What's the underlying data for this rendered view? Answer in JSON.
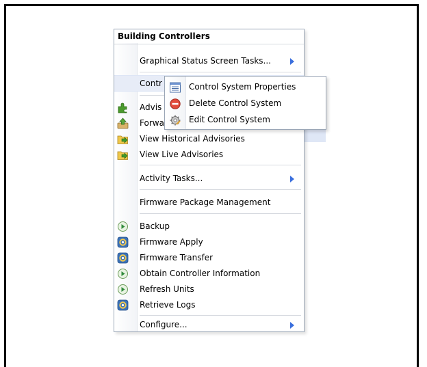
{
  "menu": {
    "title": "Building Controllers",
    "items": [
      {
        "label": "Graphical Status Screen Tasks...",
        "icon": "",
        "submenu": true
      },
      {
        "label": "Contr",
        "icon": "",
        "submenu": false,
        "hovered": true
      },
      {
        "label": "Advis",
        "icon": "puzzle-green-icon"
      },
      {
        "label": "Forwa",
        "icon": "forward-upload-icon"
      },
      {
        "label": "View Historical Advisories",
        "icon": "folder-arrow-icon"
      },
      {
        "label": "View Live Advisories",
        "icon": "folder-arrow-icon"
      },
      {
        "label": "Activity Tasks...",
        "icon": "",
        "submenu": true
      },
      {
        "label": "Firmware Package Management",
        "icon": ""
      },
      {
        "label": "Backup",
        "icon": "play-circle-icon"
      },
      {
        "label": "Firmware Apply",
        "icon": "gear-refresh-icon"
      },
      {
        "label": "Firmware Transfer",
        "icon": "gear-refresh-icon"
      },
      {
        "label": "Obtain Controller Information",
        "icon": "play-circle-icon"
      },
      {
        "label": "Refresh Units",
        "icon": "play-circle-icon"
      },
      {
        "label": "Retrieve Logs",
        "icon": "gear-refresh-icon"
      },
      {
        "label": "Configure...",
        "icon": "",
        "submenu": true
      }
    ]
  },
  "submenu": {
    "items": [
      {
        "label": "Control System Properties",
        "icon": "properties-list-icon"
      },
      {
        "label": "Delete Control System",
        "icon": "delete-red-circle-icon"
      },
      {
        "label": "Edit Control System",
        "icon": "edit-gear-icon"
      }
    ]
  },
  "colors": {
    "arrow": "#3a6fdd",
    "hover": "#e7ecf7",
    "border": "#9aa6b6"
  }
}
